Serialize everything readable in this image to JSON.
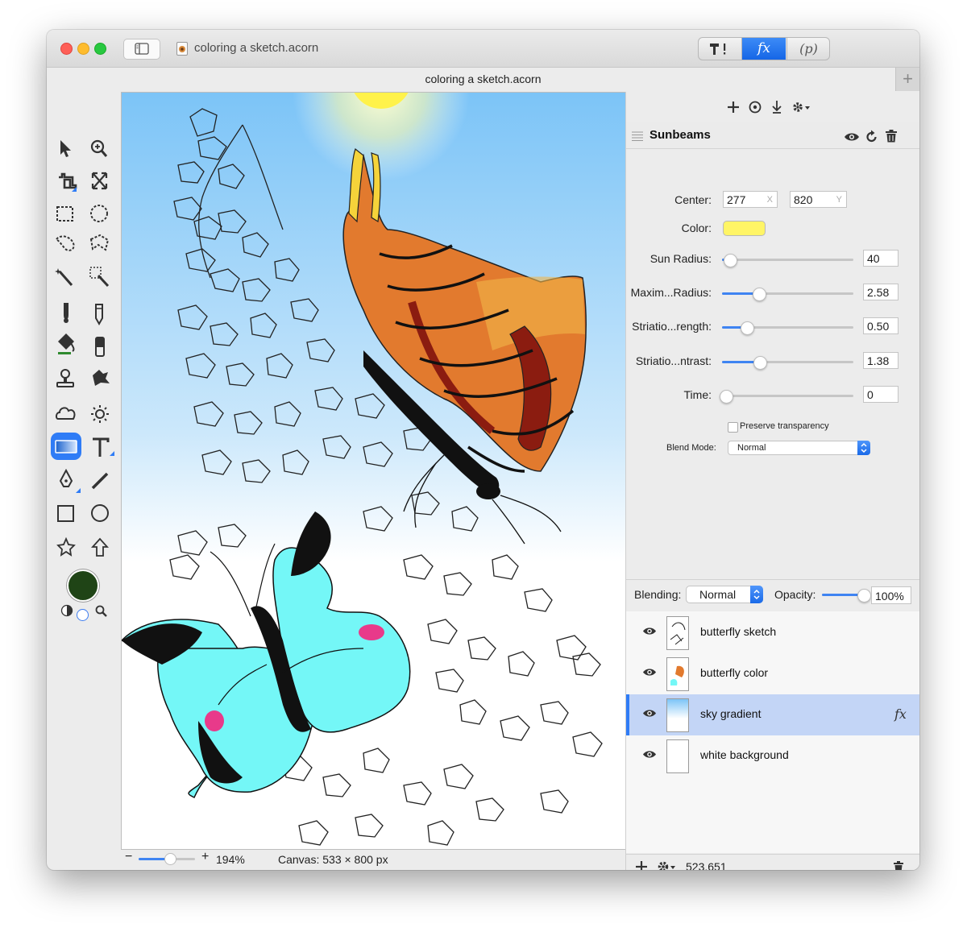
{
  "window": {
    "title": "coloring a sketch.acorn",
    "subtitle": "coloring a sketch.acorn",
    "segmented": [
      "T!",
      "fx",
      "(p)"
    ],
    "segmented_selected": "fx"
  },
  "tools": {
    "rows": [
      [
        "arrow-tool",
        "zoom-tool"
      ],
      [
        "crop-tool",
        "transform-tool"
      ],
      [
        "rect-select-tool",
        "ellipse-select-tool"
      ],
      [
        "lasso-tool",
        "polygon-lasso-tool"
      ],
      [
        "magic-wand-tool",
        "instant-alpha-tool"
      ],
      [
        "brush-tool",
        "pencil-tool"
      ],
      [
        "paint-bucket-tool",
        "eraser-tool"
      ],
      [
        "clone-stamp-tool",
        "smudge-tool"
      ],
      [
        "cloud-tool",
        "sun-tool"
      ],
      [
        "gradient-tool",
        "text-tool"
      ],
      [
        "pen-tool",
        "line-tool"
      ],
      [
        "rectangle-shape-tool",
        "oval-shape-tool"
      ],
      [
        "star-tool",
        "arrow-shape-tool"
      ]
    ],
    "selected": "gradient-tool",
    "foreground_color": "#1f4416",
    "background_color": "#ffffff"
  },
  "canvas": {
    "zoom": "194%",
    "size_text": "Canvas: 533 × 800 px",
    "zoom_slider_value": 0.55,
    "sky_top_color": "#7cc4f7",
    "sun_color": "#fff24a",
    "butterfly_orange": "#e27a2e",
    "butterfly_cyan": "#74f7f7"
  },
  "filter": {
    "name": "Sunbeams",
    "center_label": "Center:",
    "center_x": "277",
    "center_x_unit": "X",
    "center_y": "820",
    "center_y_unit": "Y",
    "color_label": "Color:",
    "color": "#fff566",
    "params": [
      {
        "label": "Sun Radius:",
        "value": "40",
        "slider": 0.06
      },
      {
        "label": "Maxim...Radius:",
        "value": "2.58",
        "slider": 0.28
      },
      {
        "label": "Striatio...rength:",
        "value": "0.50",
        "slider": 0.19
      },
      {
        "label": "Striatio...ntrast:",
        "value": "1.38",
        "slider": 0.29
      },
      {
        "label": "Time:",
        "value": "0",
        "slider": 0.03
      }
    ],
    "preserve_label": "Preserve transparency",
    "preserve_checked": false,
    "blend_mode_label": "Blend Mode:",
    "blend_mode": "Normal"
  },
  "layer_controls": {
    "blending_label": "Blending:",
    "blending": "Normal",
    "opacity_label": "Opacity:",
    "opacity": "100%",
    "opacity_slider": 1.0
  },
  "layers": [
    {
      "name": "butterfly sketch",
      "visible": true,
      "selected": false,
      "has_fx": false
    },
    {
      "name": "butterfly color",
      "visible": true,
      "selected": false,
      "has_fx": false
    },
    {
      "name": "sky gradient",
      "visible": true,
      "selected": true,
      "has_fx": true
    },
    {
      "name": "white background",
      "visible": true,
      "selected": false,
      "has_fx": false
    }
  ],
  "layers_footer": {
    "coords": "523,651"
  },
  "fx_badge": "fx"
}
